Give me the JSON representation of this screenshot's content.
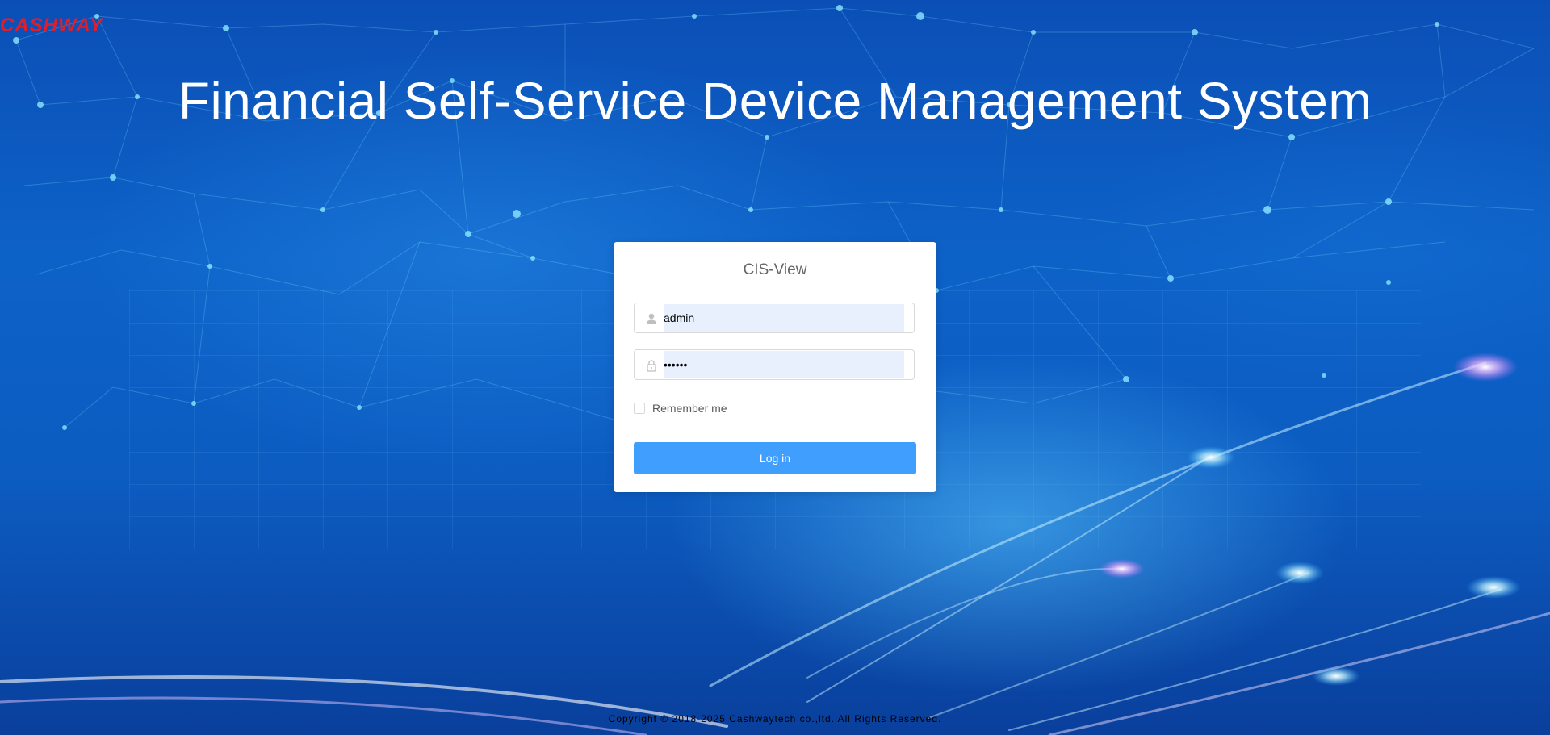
{
  "logo": {
    "text": "CASHWAY"
  },
  "header": {
    "title": "Financial Self-Service Device Management System"
  },
  "login": {
    "title": "CIS-View",
    "username": {
      "value": "admin",
      "icon": "user-icon"
    },
    "password": {
      "value": "••••••",
      "icon": "lock-icon"
    },
    "remember_label": "Remember me",
    "remember_checked": false,
    "button_label": "Log in"
  },
  "footer": {
    "copyright": "Copyright © 2018-2025 Cashwaytech co.,ltd. All Rights Reserved."
  },
  "colors": {
    "logo": "#e01e2b",
    "background": "#0d62c8",
    "button": "#409eff",
    "autofill": "#e8f0fe"
  }
}
